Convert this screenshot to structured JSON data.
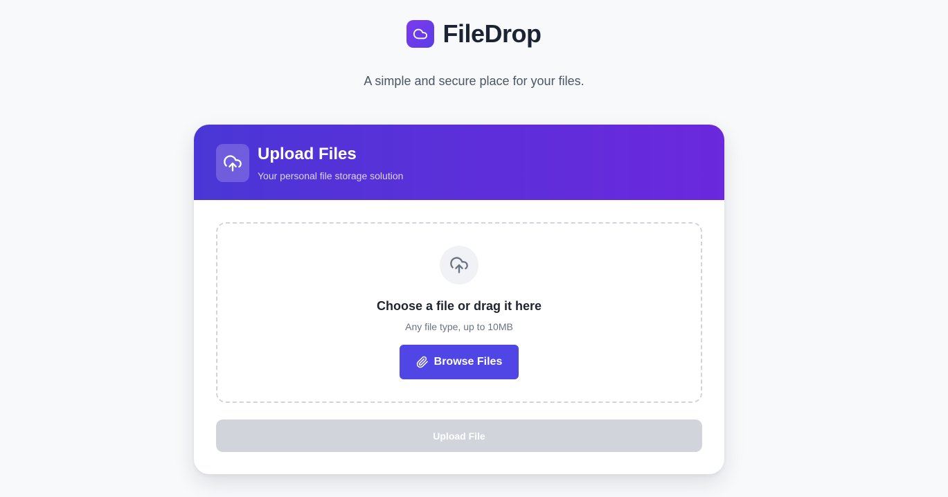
{
  "brand": {
    "name": "FileDrop",
    "logo_icon": "cloud-icon",
    "accent": "#6d28d9"
  },
  "tagline": "A simple and secure place for your files.",
  "card": {
    "header": {
      "icon": "cloud-upload-icon",
      "title": "Upload Files",
      "subtitle": "Your personal file storage solution",
      "gradient": [
        "#4a36d6",
        "#6b28dd"
      ]
    },
    "dropzone": {
      "icon": "cloud-upload-icon",
      "title": "Choose a file or drag it here",
      "hint": "Any file type, up to 10MB",
      "browse_button": {
        "icon": "paperclip-icon",
        "label": "Browse Files",
        "color": "#4f46e5"
      }
    },
    "upload_button": {
      "label": "Upload File",
      "disabled": true,
      "color": "#d1d5db"
    }
  }
}
